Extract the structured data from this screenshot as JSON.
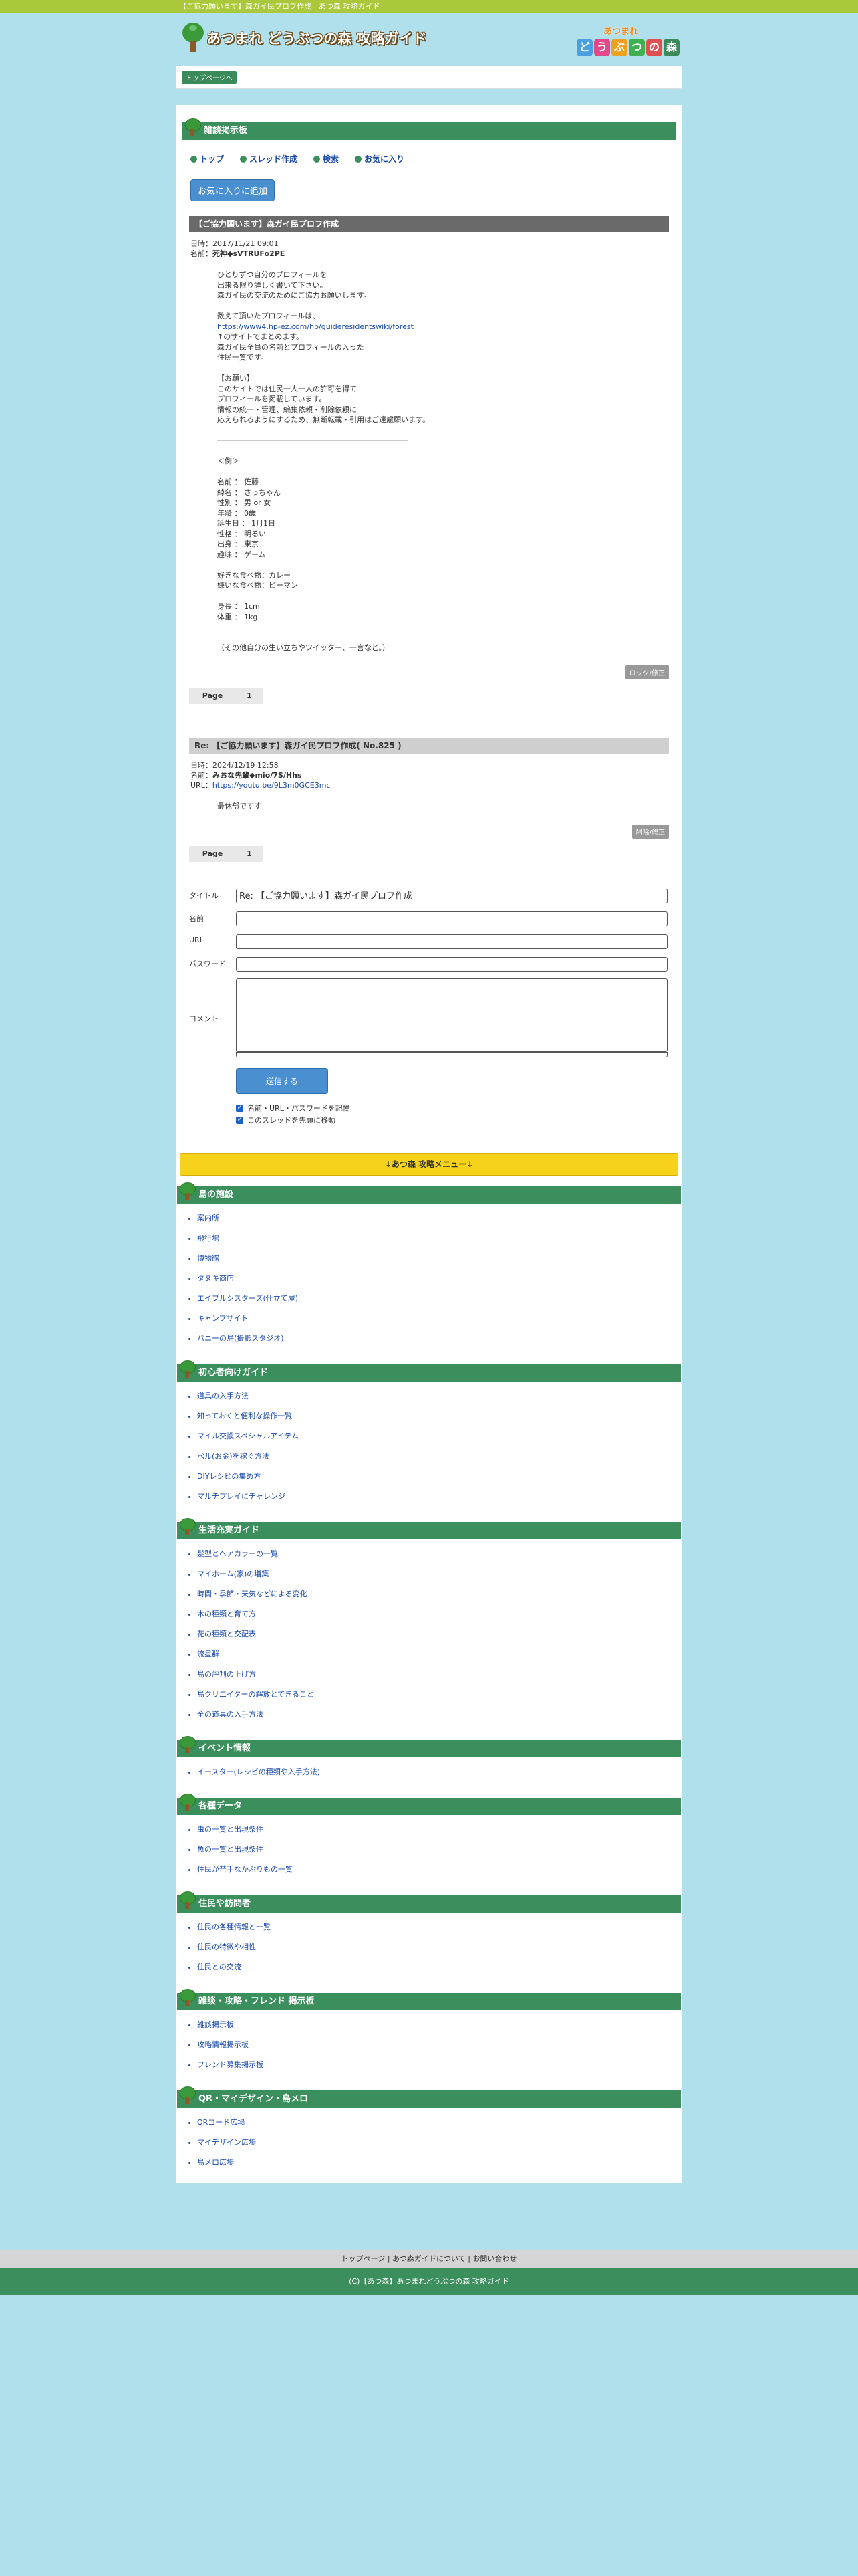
{
  "topbar": "【ご協力願います】森ガイ民プロフ作成｜あつ森 攻略ガイド",
  "site_title": "あつまれ どうぶつの森 攻略ガイド",
  "badge": {
    "top": "あつまれ",
    "chars": [
      "ど",
      "う",
      "ぶ",
      "つ",
      "の",
      "森"
    ],
    "colors": [
      "#4aa0e0",
      "#e04a8a",
      "#f0a020",
      "#40b050",
      "#e05050",
      "#3a8a5a"
    ]
  },
  "breadcrumb": "トップページへ",
  "bbs": {
    "title": "雑談掲示板",
    "nav": [
      "トップ",
      "スレッド作成",
      "検索",
      "お気に入り"
    ],
    "fav_button": "お気に入りに追加",
    "post1": {
      "title": "【ご協力願います】森ガイ民プロフ作成",
      "date": "日時：2017/11/21 09:01",
      "name_label": "名前：",
      "name": "死神◆sVTRUFo2PE",
      "body_a": "ひとりずつ自分のプロフィールを\n出来る限り詳しく書いて下さい。\n森ガイ民の交流のためにご協力お願いします。\n\n数えて頂いたプロフィールは、",
      "link": "https://www4.hp-ez.com/hp/guideresidentswiki/forest",
      "body_b": "↑のサイトでまとめます。\n森ガイ民全員の名前とプロフィールの入った\n住民一覧です。\n\n【お願い】\nこのサイトでは住民一人一人の許可を得て\nプロフィールを掲載しています。\n情報の統一・管理、編集依頼・削除依頼に\n応えられるようにするため、無断転載・引用はご遠慮願います。\n\n――――――――――――――――――――――――――\n\n＜例＞\n\n名前 ： 佐藤\n綽名 ： さっちゃん\n性別 ： 男 or 女\n年齢 ： 0歳\n誕生日 ： 1月1日\n性格 ： 明るい\n出身 ： 東京\n趣味 ： ゲーム\n\n好きな食べ物：カレー\n嫌いな食べ物：ピーマン\n\n身長 ： 1cm\n体重 ： 1kg\n\n\n（その他自分の生い立ちやツイッター、一言など。）",
      "button": "ロック/修正"
    },
    "pager": {
      "label": "Page",
      "num": "1"
    },
    "post2": {
      "title": "Re: 【ご協力願います】森ガイ民プロフ作成( No.825 )",
      "date": "日時：2024/12/19 12:58",
      "name_label": "名前：",
      "name": "みおな先輩◆mio/7S/Hhs",
      "url_label": "URL：",
      "url": "https://youtu.be/9L3m0GCE3mc",
      "body": "最休部ですす",
      "button": "削除/修正"
    }
  },
  "form": {
    "title_label": "タイトル",
    "title_value": "Re: 【ご協力願います】森ガイ民プロフ作成",
    "name_label": "名前",
    "url_label": "URL",
    "password_label": "パスワード",
    "comment_label": "コメント",
    "submit": "送信する",
    "check1": "名前・URL・パスワードを記憶",
    "check2": "このスレッドを先頭に移動"
  },
  "menu_bar": "↓あつ森 攻略メニュー↓",
  "categories": [
    {
      "title": "島の施設",
      "items": [
        "案内所",
        "飛行場",
        "博物館",
        "タヌキ商店",
        "エイブルシスターズ(仕立て屋)",
        "キャンプサイト",
        "パニーの島(撮影スタジオ)"
      ]
    },
    {
      "title": "初心者向けガイド",
      "items": [
        "道具の入手方法",
        "知っておくと便利な操作一覧",
        "マイル交換スペシャルアイテム",
        "ベル(お金)を稼ぐ方法",
        "DIYレシピの集め方",
        "マルチプレイにチャレンジ"
      ]
    },
    {
      "title": "生活充実ガイド",
      "items": [
        "髪型とヘアカラーの一覧",
        "マイホーム(家)の増築",
        "時間・季節・天気などによる変化",
        "木の種類と育て方",
        "花の種類と交配表",
        "流星群",
        "島の評判の上げ方",
        "島クリエイターの解放とできること",
        "全の道具の入手方法"
      ]
    },
    {
      "title": "イベント情報",
      "items": [
        "イースター(レシピの種類や入手方法)"
      ]
    },
    {
      "title": "各種データ",
      "items": [
        "虫の一覧と出現条件",
        "魚の一覧と出現条件",
        "住民が苦手なかぶりもの一覧"
      ]
    },
    {
      "title": "住民や訪問者",
      "items": [
        "住民の各種情報と一覧",
        "住民の特徴や相性",
        "住民との交流"
      ]
    },
    {
      "title": "雑談・攻略・フレンド 掲示板",
      "items": [
        "雑談掲示板",
        "攻略情報掲示板",
        "フレンド募集掲示板"
      ]
    },
    {
      "title": "QR・マイデザイン・島メロ",
      "items": [
        "QRコード広場",
        "マイデザイン広場",
        "島メロ広場"
      ]
    }
  ],
  "footer_links": "トップページ | あつ森ガイドについて | お問い合わせ",
  "copyright": "(C)【あつ森】あつまれどうぶつの森 攻略ガイド"
}
